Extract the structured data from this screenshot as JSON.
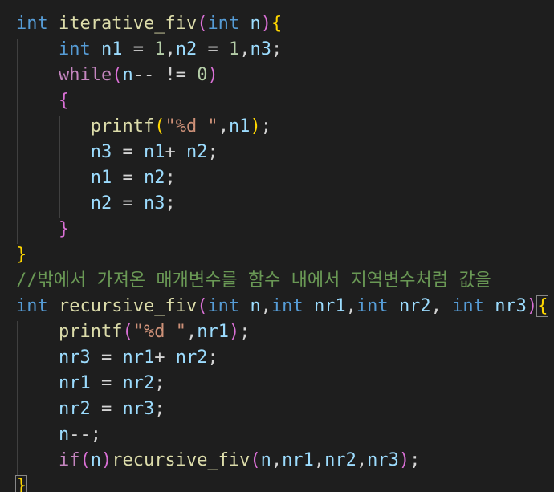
{
  "code_lines": [
    [
      {
        "t": "int",
        "c": "kw"
      },
      {
        "t": " ",
        "c": "pn"
      },
      {
        "t": "iterative_fiv",
        "c": "fn"
      },
      {
        "t": "(",
        "c": "br2"
      },
      {
        "t": "int",
        "c": "kw"
      },
      {
        "t": " ",
        "c": "pn"
      },
      {
        "t": "n",
        "c": "var"
      },
      {
        "t": ")",
        "c": "br2"
      },
      {
        "t": "{",
        "c": "br1"
      }
    ],
    [
      {
        "t": "    ",
        "c": "pn"
      },
      {
        "t": "int",
        "c": "kw"
      },
      {
        "t": " ",
        "c": "pn"
      },
      {
        "t": "n1",
        "c": "var"
      },
      {
        "t": " = ",
        "c": "pn"
      },
      {
        "t": "1",
        "c": "num"
      },
      {
        "t": ",",
        "c": "pn"
      },
      {
        "t": "n2",
        "c": "var"
      },
      {
        "t": " = ",
        "c": "pn"
      },
      {
        "t": "1",
        "c": "num"
      },
      {
        "t": ",",
        "c": "pn"
      },
      {
        "t": "n3",
        "c": "var"
      },
      {
        "t": ";",
        "c": "pn"
      }
    ],
    [
      {
        "t": "    ",
        "c": "pn"
      },
      {
        "t": "while",
        "c": "ctl"
      },
      {
        "t": "(",
        "c": "br2"
      },
      {
        "t": "n",
        "c": "var"
      },
      {
        "t": "-- != ",
        "c": "pn"
      },
      {
        "t": "0",
        "c": "num"
      },
      {
        "t": ")",
        "c": "br2"
      }
    ],
    [
      {
        "t": "    ",
        "c": "pn"
      },
      {
        "t": "{",
        "c": "br2"
      }
    ],
    [
      {
        "t": "       ",
        "c": "pn"
      },
      {
        "t": "printf",
        "c": "fn"
      },
      {
        "t": "(",
        "c": "br1"
      },
      {
        "t": "\"%d \"",
        "c": "str"
      },
      {
        "t": ",",
        "c": "pn"
      },
      {
        "t": "n1",
        "c": "var"
      },
      {
        "t": ")",
        "c": "br1"
      },
      {
        "t": ";",
        "c": "pn"
      }
    ],
    [
      {
        "t": "       ",
        "c": "pn"
      },
      {
        "t": "n3",
        "c": "var"
      },
      {
        "t": " = ",
        "c": "pn"
      },
      {
        "t": "n1",
        "c": "var"
      },
      {
        "t": "+ ",
        "c": "pn"
      },
      {
        "t": "n2",
        "c": "var"
      },
      {
        "t": ";",
        "c": "pn"
      }
    ],
    [
      {
        "t": "       ",
        "c": "pn"
      },
      {
        "t": "n1",
        "c": "var"
      },
      {
        "t": " = ",
        "c": "pn"
      },
      {
        "t": "n2",
        "c": "var"
      },
      {
        "t": ";",
        "c": "pn"
      }
    ],
    [
      {
        "t": "       ",
        "c": "pn"
      },
      {
        "t": "n2",
        "c": "var"
      },
      {
        "t": " = ",
        "c": "pn"
      },
      {
        "t": "n3",
        "c": "var"
      },
      {
        "t": ";",
        "c": "pn"
      }
    ],
    [
      {
        "t": "    ",
        "c": "pn"
      },
      {
        "t": "}",
        "c": "br2"
      }
    ],
    [
      {
        "t": "}",
        "c": "br1"
      }
    ],
    [
      {
        "t": "//밖에서 가져온 매개변수를 함수 내에서 지역변수처럼 값을",
        "c": "cmt"
      }
    ],
    [
      {
        "t": "int",
        "c": "kw"
      },
      {
        "t": " ",
        "c": "pn"
      },
      {
        "t": "recursive_fiv",
        "c": "fn"
      },
      {
        "t": "(",
        "c": "br2"
      },
      {
        "t": "int",
        "c": "kw"
      },
      {
        "t": " ",
        "c": "pn"
      },
      {
        "t": "n",
        "c": "var"
      },
      {
        "t": ",",
        "c": "pn"
      },
      {
        "t": "int",
        "c": "kw"
      },
      {
        "t": " ",
        "c": "pn"
      },
      {
        "t": "nr1",
        "c": "var"
      },
      {
        "t": ",",
        "c": "pn"
      },
      {
        "t": "int",
        "c": "kw"
      },
      {
        "t": " ",
        "c": "pn"
      },
      {
        "t": "nr2",
        "c": "var"
      },
      {
        "t": ", ",
        "c": "pn"
      },
      {
        "t": "int",
        "c": "kw"
      },
      {
        "t": " ",
        "c": "pn"
      },
      {
        "t": "nr3",
        "c": "var"
      },
      {
        "t": ")",
        "c": "br2"
      },
      {
        "t": "{",
        "c": "br1 match"
      }
    ],
    [
      {
        "t": "    ",
        "c": "pn"
      },
      {
        "t": "printf",
        "c": "fn"
      },
      {
        "t": "(",
        "c": "br2"
      },
      {
        "t": "\"%d \"",
        "c": "str"
      },
      {
        "t": ",",
        "c": "pn"
      },
      {
        "t": "nr1",
        "c": "var"
      },
      {
        "t": ")",
        "c": "br2"
      },
      {
        "t": ";",
        "c": "pn"
      }
    ],
    [
      {
        "t": "    ",
        "c": "pn"
      },
      {
        "t": "nr3",
        "c": "var"
      },
      {
        "t": " = ",
        "c": "pn"
      },
      {
        "t": "nr1",
        "c": "var"
      },
      {
        "t": "+ ",
        "c": "pn"
      },
      {
        "t": "nr2",
        "c": "var"
      },
      {
        "t": ";",
        "c": "pn"
      }
    ],
    [
      {
        "t": "    ",
        "c": "pn"
      },
      {
        "t": "nr1",
        "c": "var"
      },
      {
        "t": " = ",
        "c": "pn"
      },
      {
        "t": "nr2",
        "c": "var"
      },
      {
        "t": ";",
        "c": "pn"
      }
    ],
    [
      {
        "t": "    ",
        "c": "pn"
      },
      {
        "t": "nr2",
        "c": "var"
      },
      {
        "t": " = ",
        "c": "pn"
      },
      {
        "t": "nr3",
        "c": "var"
      },
      {
        "t": ";",
        "c": "pn"
      }
    ],
    [
      {
        "t": "    ",
        "c": "pn"
      },
      {
        "t": "n",
        "c": "var"
      },
      {
        "t": "--;",
        "c": "pn"
      }
    ],
    [
      {
        "t": "    ",
        "c": "pn"
      },
      {
        "t": "if",
        "c": "ctl"
      },
      {
        "t": "(",
        "c": "br2"
      },
      {
        "t": "n",
        "c": "var"
      },
      {
        "t": ")",
        "c": "br2"
      },
      {
        "t": "recursive_fiv",
        "c": "fn"
      },
      {
        "t": "(",
        "c": "br2"
      },
      {
        "t": "n",
        "c": "var"
      },
      {
        "t": ",",
        "c": "pn"
      },
      {
        "t": "nr1",
        "c": "var"
      },
      {
        "t": ",",
        "c": "pn"
      },
      {
        "t": "nr2",
        "c": "var"
      },
      {
        "t": ",",
        "c": "pn"
      },
      {
        "t": "nr3",
        "c": "var"
      },
      {
        "t": ")",
        "c": "br2"
      },
      {
        "t": ";",
        "c": "pn"
      }
    ],
    [
      {
        "t": "}",
        "c": "br1 match"
      }
    ]
  ]
}
